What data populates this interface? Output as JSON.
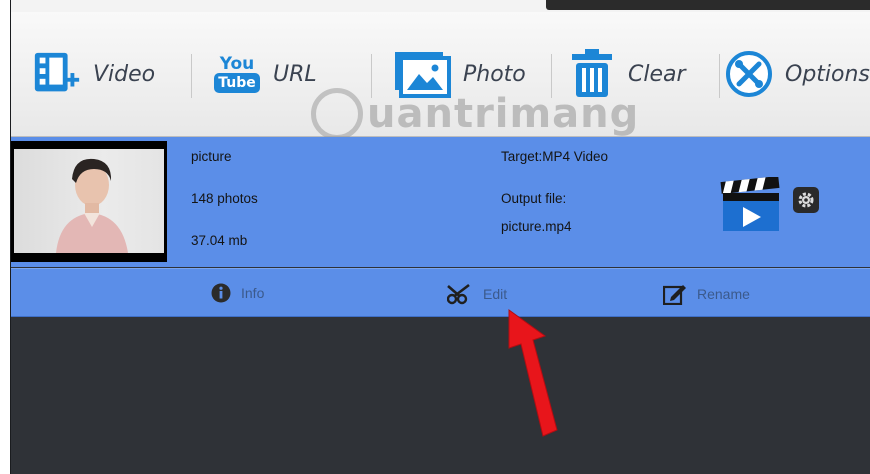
{
  "toolbar": {
    "buttons": [
      {
        "label": "Video",
        "icon": "add-video-icon"
      },
      {
        "label": "URL",
        "icon": "youtube-icon",
        "icon_text_top": "You",
        "icon_text_bottom": "Tube"
      },
      {
        "label": "Photo",
        "icon": "photo-icon"
      },
      {
        "label": "Clear",
        "icon": "trash-icon"
      },
      {
        "label": "Options",
        "icon": "tools-icon"
      }
    ]
  },
  "watermark": {
    "text": "uantrimang"
  },
  "item": {
    "name": "picture",
    "photos": "148 photos",
    "size": "37.04 mb",
    "target": "Target:MP4 Video",
    "output_label": "Output file:",
    "output_file": "picture.mp4"
  },
  "actions": [
    {
      "label": "Info",
      "icon": "info-icon"
    },
    {
      "label": "Edit",
      "icon": "scissors-icon"
    },
    {
      "label": "Rename",
      "icon": "rename-icon"
    }
  ],
  "colors": {
    "accent": "#5b8ee8",
    "icon_blue": "#1c86d6",
    "background_dark": "#2f3237",
    "arrow": "#e8151b"
  }
}
